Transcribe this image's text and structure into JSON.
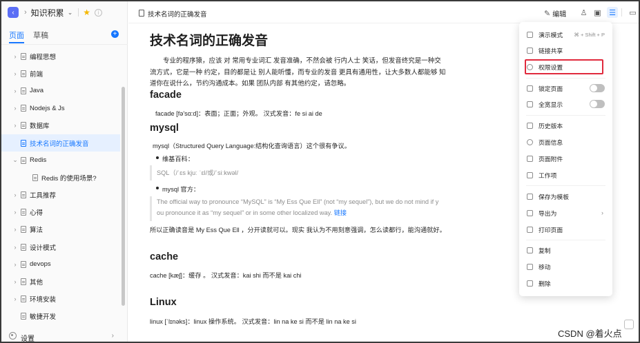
{
  "sidebar": {
    "kb_title": "知识积累",
    "tabs": {
      "pages": "页面",
      "drafts": "草稿"
    },
    "tree": [
      {
        "label": "编程思想",
        "caret": "›"
      },
      {
        "label": "前端",
        "caret": "›"
      },
      {
        "label": "Java",
        "caret": "›"
      },
      {
        "label": "Nodejs & Js",
        "caret": "›"
      },
      {
        "label": "数据库",
        "caret": "›"
      },
      {
        "label": "技术名词的正确发音",
        "caret": ""
      },
      {
        "label": "Redis",
        "caret": "⌄"
      },
      {
        "label": "Redis 的使用场景?",
        "caret": ""
      },
      {
        "label": "工具推荐",
        "caret": "›"
      },
      {
        "label": "心得",
        "caret": "›"
      },
      {
        "label": "算法",
        "caret": "›"
      },
      {
        "label": "设计模式",
        "caret": "›"
      },
      {
        "label": "devops",
        "caret": "›"
      },
      {
        "label": "其他",
        "caret": "›"
      },
      {
        "label": "环境安装",
        "caret": "›"
      },
      {
        "label": "敏捷开发",
        "caret": ""
      }
    ],
    "settings_label": "设置"
  },
  "header": {
    "doc_title": "技术名词的正确发音",
    "edit_label": "编辑"
  },
  "content": {
    "title": "技术名词的正确发音",
    "intro": "专业的程序猿，应该 对 常用专业词汇 发音准确，不然会被 行内人士 笑话，但发音终究是一种交流方式，它是一种 约定，目的都是让 别人能听懂，而专业的发音 更具有通用性，让大多数人都能够 知道你在说什么，节约沟通成本。如果 团队内部 有其他约定，请忽略。",
    "facade": {
      "heading": "facade",
      "line": "facade [fə'sɑ:d]：表面；正面；外观。 汉式发音：fe si ai de"
    },
    "mysql": {
      "heading": "mysql",
      "line": "mysql（Structured Query Language:结构化查询语言）这个很有争议。",
      "bullet1": "维基百科：",
      "quote1": "SQL（/ˈɛs kjuː ˈɛl/或/ˈsiːkwəl/",
      "bullet2": "mysql 官方：",
      "quote2_a": "The official way to pronounce “MySQL” is “My Ess Que Ell” (not “my sequel”), but we do not mind if y",
      "quote2_b": "ou pronounce it as “my sequel” or in some other localized way.",
      "quote2_link": "链接",
      "summary": "所以正确读音是 My Ess Que Ell ，分开读就可以。现实 我认为不用刻意强调，怎么读都行，能沟通就好。"
    },
    "cache": {
      "heading": "cache",
      "line": "cache [kæʃ]：缓存 。 汉式发音：kai shi 而不是 kai chi"
    },
    "linux": {
      "heading": "Linux",
      "line": "linux [ˈlɪnəks]：linux 操作系统。 汉式发音：lin na ke si 而不是 lin na ke si"
    }
  },
  "menu": {
    "present": {
      "label": "演示模式",
      "shortcut": "⌘ + Shift + P"
    },
    "share": "链接共享",
    "permissions": "权限设置",
    "lock": "锁定页面",
    "fullwidth": "全宽显示",
    "history": "历史版本",
    "info": "页面信息",
    "attachments": "页面附件",
    "workitems": "工作项",
    "save_template": "保存为模板",
    "export": "导出为",
    "print": "打印页面",
    "copy": "复制",
    "move": "移动",
    "delete": "删除"
  },
  "watermark": "CSDN @着火点",
  "colors": {
    "accent": "#1677ff",
    "highlight_border": "#e0293c",
    "kb_icon": "#5b6ef5"
  }
}
